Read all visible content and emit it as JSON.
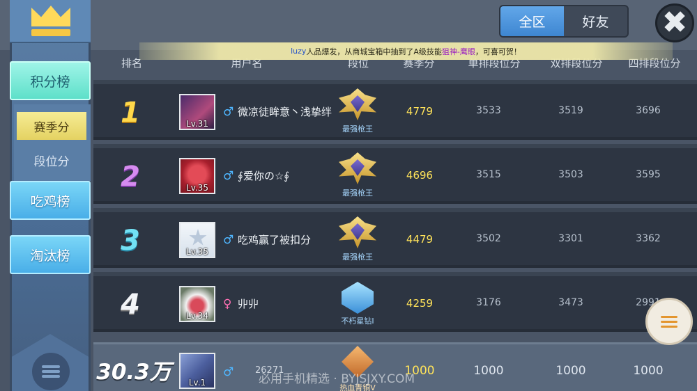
{
  "scope_tabs": {
    "all": "全区",
    "friends": "好友"
  },
  "close": "✖",
  "notice": {
    "player": "luzy",
    "text1": "人品爆发，从商城宝箱中抽到了A级技能",
    "skill": "狙神-鹰眼",
    "text2": "，可喜可贺！"
  },
  "columns": {
    "rank": "排名",
    "user": "用户名",
    "tier": "段位",
    "season": "赛季分",
    "single": "单排段位分",
    "double": "双排段位分",
    "quad": "四排段位分"
  },
  "sidebar": {
    "score_board": "积分榜",
    "season_score": "赛季分",
    "tier_score": "段位分",
    "chicken_board": "吃鸡榜",
    "elim_board": "淘汰榜"
  },
  "rows": [
    {
      "rank": "1",
      "level": "Lv.31",
      "gender": "♂",
      "name": "微凉徒眸意丶浅挚绊",
      "tier": "最强枪王",
      "season": "4779",
      "single": "3533",
      "double": "3519",
      "quad": "3696"
    },
    {
      "rank": "2",
      "level": "Lv.35",
      "gender": "♂",
      "name": "∮爱你の☆∮",
      "tier": "最强枪王",
      "season": "4696",
      "single": "3515",
      "double": "3503",
      "quad": "3595"
    },
    {
      "rank": "3",
      "level": "Lv.35",
      "gender": "♂",
      "name": "吃鸡赢了被扣分",
      "tier": "最强枪王",
      "season": "4479",
      "single": "3502",
      "double": "3301",
      "quad": "3362"
    },
    {
      "rank": "4",
      "level": "Lv.34",
      "gender": "♀",
      "name": "丱丱",
      "tier": "不朽星钻I",
      "season": "4259",
      "single": "3176",
      "double": "3473",
      "quad": "2991"
    }
  ],
  "me": {
    "rank": "30.3万",
    "level": "Lv.1",
    "gender": "♂",
    "name": "26271",
    "tier": "热血青铜V",
    "season": "1000",
    "single": "1000",
    "double": "1000",
    "quad": "1000"
  },
  "watermark": "必用手机精选 · BYJSJXY.COM",
  "colors": {
    "accent_blue": "#4a95de",
    "season_yellow": "#ffe35a",
    "score_tab": "#5ee0c9"
  }
}
